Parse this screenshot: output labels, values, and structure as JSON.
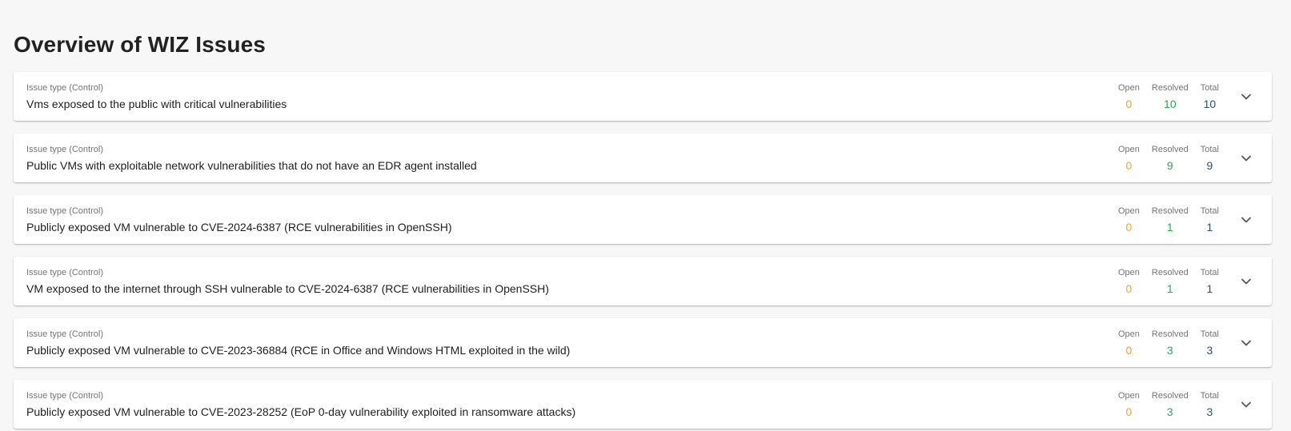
{
  "page": {
    "title": "Overview of WIZ Issues"
  },
  "colors": {
    "open": "#f2a03d",
    "resolved": "#2ea852",
    "total": "#2b4f8a"
  },
  "stat_labels": {
    "open": "Open",
    "resolved": "Resolved",
    "total": "Total"
  },
  "issues": [
    {
      "type_label": "Issue type (Control)",
      "title": "Vms exposed to the public with critical vulnerabilities",
      "open": "0",
      "resolved": "10",
      "total": "10",
      "icon": "chevron-down-icon"
    },
    {
      "type_label": "Issue type (Control)",
      "title": "Public VMs with exploitable network vulnerabilities that do not have an EDR agent installed",
      "open": "0",
      "resolved": "9",
      "total": "9",
      "icon": "chevron-down-icon"
    },
    {
      "type_label": "Issue type (Control)",
      "title": "Publicly exposed VM vulnerable to CVE-2024-6387 (RCE vulnerabilities in OpenSSH)",
      "open": "0",
      "resolved": "1",
      "total": "1",
      "icon": "chevron-down-icon"
    },
    {
      "type_label": "Issue type (Control)",
      "title": "VM exposed to the internet through SSH vulnerable to CVE-2024-6387 (RCE vulnerabilities in OpenSSH)",
      "open": "0",
      "resolved": "1",
      "total": "1",
      "icon": "chevron-down-icon"
    },
    {
      "type_label": "Issue type (Control)",
      "title": "Publicly exposed VM vulnerable to CVE-2023-36884 (RCE in Office and Windows HTML exploited in the wild)",
      "open": "0",
      "resolved": "3",
      "total": "3",
      "icon": "chevron-down-icon"
    },
    {
      "type_label": "Issue type (Control)",
      "title": "Publicly exposed VM vulnerable to CVE-2023-28252 (EoP 0-day vulnerability exploited in ransomware attacks)",
      "open": "0",
      "resolved": "3",
      "total": "3",
      "icon": "chevron-down-icon"
    }
  ]
}
